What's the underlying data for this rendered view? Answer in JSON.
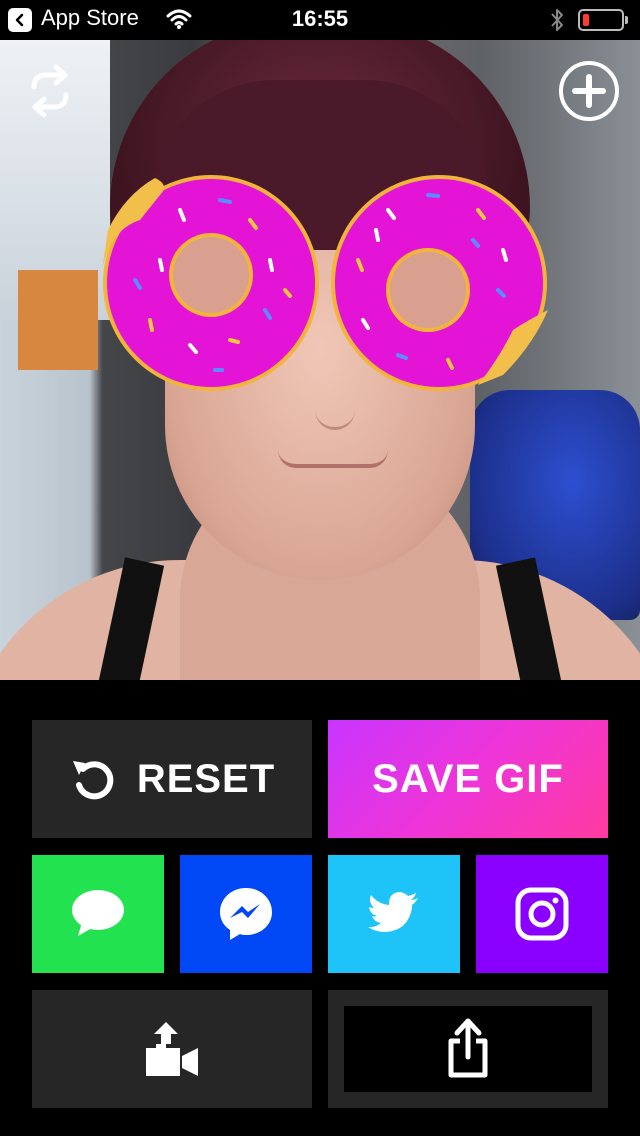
{
  "status_bar": {
    "back_label": "App Store",
    "time": "16:55",
    "battery_level": 0.18,
    "battery_color": "#ff3b30"
  },
  "photo": {
    "effect_icons": [
      "donut-glasses-left",
      "donut-glasses-right"
    ]
  },
  "buttons": {
    "reset_label": "RESET",
    "save_gif_label": "SAVE GIF"
  },
  "share_targets": [
    {
      "name": "messages",
      "color": "#22e34f",
      "icon": "message-bubble-icon"
    },
    {
      "name": "messenger",
      "color": "#0047f5",
      "icon": "messenger-icon"
    },
    {
      "name": "twitter",
      "color": "#1ec3f8",
      "icon": "twitter-bird-icon"
    },
    {
      "name": "instagram",
      "color": "#8a00ff",
      "icon": "instagram-icon"
    }
  ],
  "colors": {
    "save_gradient_start": "#c935ff",
    "save_gradient_end": "#ff3aa0",
    "tile_dark": "#262626"
  }
}
